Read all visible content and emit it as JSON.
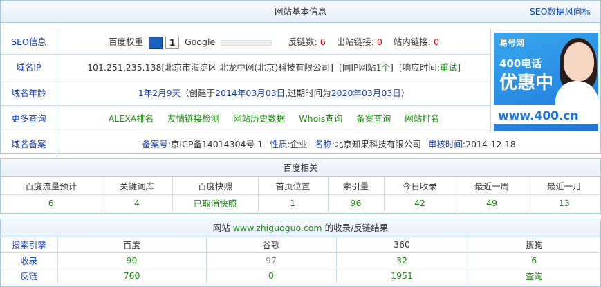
{
  "info": {
    "title": "网站基本信息",
    "seo_link": "SEO数据风向标",
    "labels": {
      "seo": "SEO信息",
      "ip": "域名IP",
      "age": "域名年龄",
      "more": "更多查询",
      "icp": "域名备案"
    },
    "seo": {
      "baidu_label": "百度权重",
      "baidu_icon": "paw-icon",
      "baidu_value": "1",
      "google_label": "Google",
      "backlinks_label": "反链数:",
      "backlinks": "6",
      "outlinks_label": "出站链接:",
      "outlinks": "0",
      "inlinks_label": "站内链接:",
      "inlinks": "0"
    },
    "ip": {
      "address": "101.251.235.138",
      "location": "[北京市海淀区 北龙中网(北京)科技有限公司]",
      "same_ip_pre": "[同IP网站",
      "same_ip_count": "1个",
      "same_ip_post": "]",
      "resp_pre": "[响应时间:",
      "resp_value": "重试",
      "resp_post": "]"
    },
    "age": {
      "duration": "1年2月9天",
      "created_pre": "（创建于",
      "created": "2014年03月03日",
      "expire_pre": ",过期时间为",
      "expire": "2020年03月03日",
      "post": "）"
    },
    "more": [
      "ALEXA排名",
      "友情链接检测",
      "网站历史数据",
      "Whois查询",
      "备案查询",
      "网站排名"
    ],
    "icp": {
      "no_label": "备案号:",
      "no": "京ICP备14014304号-1",
      "nature_label": "性质:",
      "nature": "企业",
      "name_label": "名称:",
      "name": "北京知果科技有限公司",
      "date_label": "审核时间:",
      "date": "2014-12-18"
    },
    "ad": {
      "brand": "易号网",
      "line1": "400电话",
      "line2": "优惠中",
      "url": "www.400.cn"
    }
  },
  "baidu": {
    "title": "百度相关",
    "headers": [
      "百度流量预计",
      "关键词库",
      "百度快照",
      "首页位置",
      "索引量",
      "今日收录",
      "最近一周",
      "最近一月"
    ],
    "values": [
      "6",
      "4",
      "已取消快照",
      "1",
      "96",
      "42",
      "49",
      "13"
    ]
  },
  "index": {
    "title_pre": "网站",
    "domain": "www.zhiguoguo.com",
    "title_post": "的收录/反链结果",
    "headers": [
      "搜索引擎",
      "百度",
      "谷歌",
      "360",
      "搜狗"
    ],
    "rows": [
      {
        "label": "收录",
        "values": [
          "90",
          "97",
          "32",
          "6"
        ]
      },
      {
        "label": "反链",
        "values": [
          "760",
          "0",
          "1951",
          "查询"
        ]
      }
    ]
  }
}
